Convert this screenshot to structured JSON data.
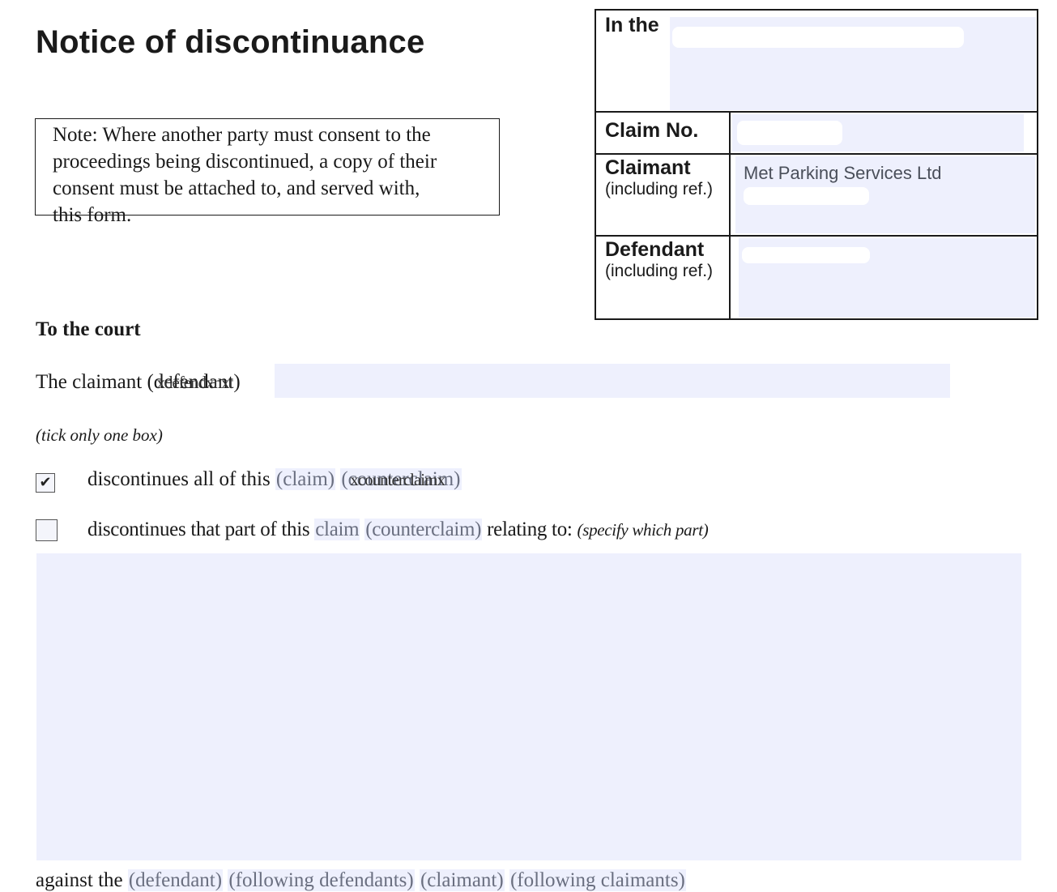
{
  "form_title": "Notice of discontinuance",
  "note": {
    "lines": [
      "Note: Where another party must consent to the",
      "proceedings being discontinued, a copy of their",
      "consent must be attached to, and served with,",
      "this form."
    ]
  },
  "header": {
    "in_the_label": "In the",
    "claim_no_label": "Claim No.",
    "claimant_label": "Claimant",
    "claimant_sub": "(including ref.)",
    "claimant_value": "Met Parking Services Ltd",
    "defendant_label": "Defendant",
    "defendant_sub": "(including ref.)"
  },
  "to_court": {
    "heading": "To the court",
    "party_prefix": "The claimant",
    "party_struck": "(defendant)",
    "party_overtype": "xdefendxnxt",
    "tick_instruction": "(tick only one box)"
  },
  "options": [
    {
      "checked": true,
      "check_glyph": "✔",
      "prefix": "discontinues all of this",
      "choice_a": "(claim)",
      "choice_b": "(counterclaim)",
      "choice_b_overtype": "xcounterclaimx"
    },
    {
      "checked": false,
      "check_glyph": "",
      "prefix": "discontinues that part of this",
      "choice_a": "claim",
      "choice_b": "(counterclaim)",
      "suffix": "relating to:",
      "hint": "(specify which part)"
    }
  ],
  "against": {
    "prefix": "against the",
    "choices": [
      "(defendant)",
      "(following defendants)",
      "(claimant)",
      "(following claimants)"
    ]
  }
}
